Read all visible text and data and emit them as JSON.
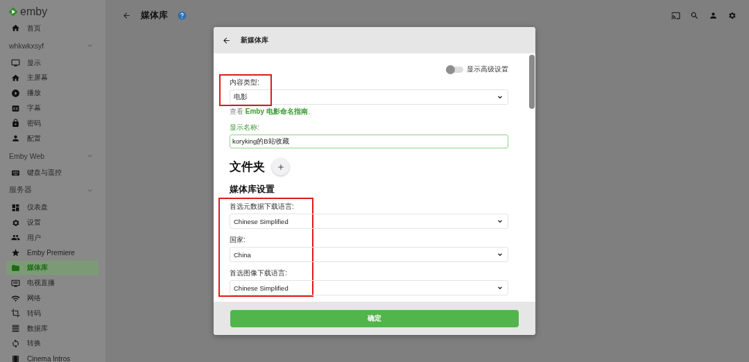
{
  "logo": {
    "text": "emby"
  },
  "sidebar": {
    "items": [
      {
        "label": "首页",
        "selected": false
      }
    ],
    "sections": [
      {
        "title": "whkwkxsyf",
        "expanded": true,
        "items": [
          {
            "label": "显示",
            "selected": false
          },
          {
            "label": "主屏幕",
            "selected": false
          },
          {
            "label": "播放",
            "selected": false
          },
          {
            "label": "字幕",
            "selected": false
          },
          {
            "label": "密码",
            "selected": false
          },
          {
            "label": "配置",
            "selected": false
          }
        ]
      },
      {
        "title": "Emby Web",
        "expanded": true,
        "items": [
          {
            "label": "键盘与遥控",
            "selected": false
          }
        ]
      },
      {
        "title": "服务器",
        "expanded": true,
        "items": [
          {
            "label": "仪表盘",
            "selected": false
          },
          {
            "label": "设置",
            "selected": false
          },
          {
            "label": "用户",
            "selected": false
          },
          {
            "label": "Emby Premiere",
            "selected": false
          },
          {
            "label": "媒体库",
            "selected": true
          },
          {
            "label": "电视直播",
            "selected": false
          },
          {
            "label": "网络",
            "selected": false
          },
          {
            "label": "转码",
            "selected": false
          },
          {
            "label": "数据库",
            "selected": false
          },
          {
            "label": "转换",
            "selected": false
          },
          {
            "label": "Cinema Intros",
            "selected": false
          }
        ]
      }
    ]
  },
  "header": {
    "title": "媒体库"
  },
  "dialog": {
    "title": "新媒体库",
    "advanced_toggle": {
      "label": "显示高级设置",
      "on": false
    },
    "content_type": {
      "label": "内容类型:",
      "value": "电影",
      "highlighted": true,
      "help": "查看 **Emby 电影命名指南**。"
    },
    "display_name": {
      "label": "显示名称:",
      "value": "koryking的B站收藏",
      "focused": true
    },
    "folders": {
      "title": "文件夹"
    },
    "library_settings": {
      "title": "媒体库设置",
      "highlighted": true,
      "fields": [
        {
          "label": "首选元数据下载语言:",
          "value": "Chinese Simplified"
        },
        {
          "label": "国家:",
          "value": "China"
        },
        {
          "label": "首选图像下载语言:",
          "value": "Chinese Simplified"
        }
      ]
    },
    "ok_button": "确定"
  }
}
